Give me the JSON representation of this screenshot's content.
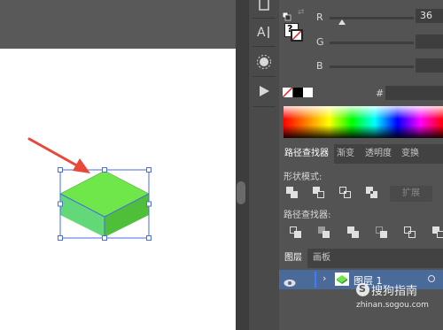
{
  "color_panel": {
    "r_label": "R",
    "g_label": "G",
    "b_label": "B",
    "r_value": "36",
    "hash_label": "#",
    "question_mark": "?"
  },
  "tabs": {
    "pathfinder": "路径查找器",
    "gradient": "渐变",
    "transparency": "透明度",
    "transform": "变换"
  },
  "pathfinder": {
    "shape_modes": "形状模式:",
    "pathfinders": "路径查找器:",
    "expand": "扩展"
  },
  "layers_tabs": {
    "layers": "图层",
    "artboards": "画板"
  },
  "layers": [
    {
      "name": "图层 1"
    }
  ],
  "watermark": {
    "brand": "搜狗指南",
    "url": "zhinan.sogou.com"
  },
  "colors": {
    "shape_top": "#6fe64a",
    "shape_side_left": "#5fd36a",
    "shape_side_right": "#4fbf3a",
    "selection": "#4a6de0",
    "arrow": "#e8473a",
    "layer_highlight": "#4a6a99"
  },
  "icons": [
    "type-icon",
    "sun-icon",
    "play-icon",
    "eye-icon",
    "chevron-right-icon"
  ]
}
